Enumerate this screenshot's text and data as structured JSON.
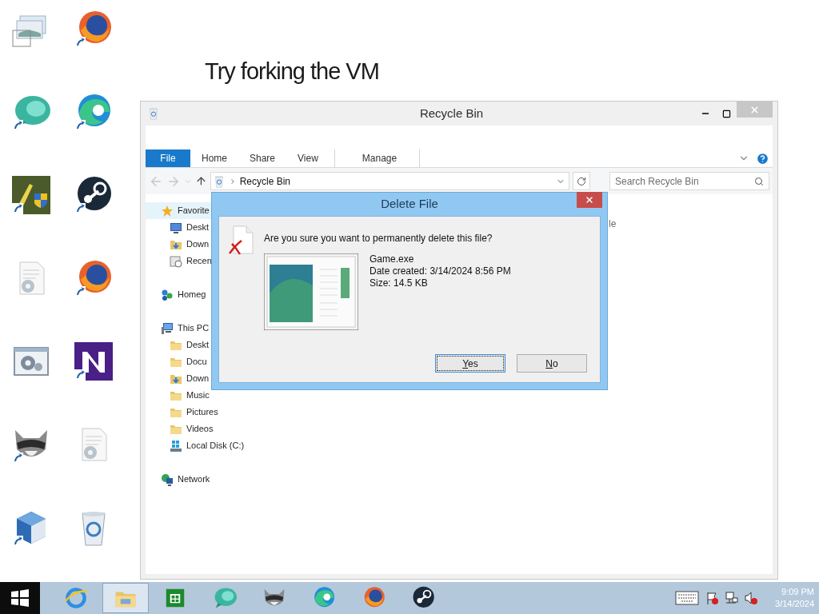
{
  "desktop": {
    "caption": "Try forking the VM",
    "icon_columns": [
      [
        {
          "kind": "windows",
          "shortcut": false
        },
        {
          "kind": "bubble",
          "shortcut": true
        },
        {
          "kind": "shield",
          "shortcut": true
        },
        {
          "kind": "docgear",
          "shortcut": false
        },
        {
          "kind": "gearwin",
          "shortcut": false
        },
        {
          "kind": "raccoon",
          "shortcut": true
        },
        {
          "kind": "cube",
          "shortcut": true
        }
      ],
      [
        {
          "kind": "globe",
          "shortcut": true
        },
        {
          "kind": "swirl",
          "shortcut": true
        },
        {
          "kind": "round",
          "shortcut": true
        },
        {
          "kind": "globe",
          "shortcut": true
        },
        {
          "kind": "square",
          "shortcut": true
        },
        {
          "kind": "docgear",
          "shortcut": false
        },
        {
          "kind": "bin",
          "shortcut": false
        }
      ]
    ]
  },
  "explorer": {
    "title": "Recycle Bin",
    "ribbon_tabs": [
      {
        "label": "File",
        "selected": true
      },
      {
        "label": "Home",
        "selected": false
      },
      {
        "label": "Share",
        "selected": false
      },
      {
        "label": "View",
        "selected": false
      },
      {
        "label": "Manage",
        "selected": false
      }
    ],
    "address": "Recycle Bin",
    "search": {
      "placeholder": "Search Recycle Bin"
    },
    "nav": [
      {
        "label": "Favorite",
        "kind": "star",
        "selected": true,
        "children": [
          {
            "label": "Deskt",
            "kind": "desktop",
            "selected": false
          },
          {
            "label": "Down",
            "kind": "download",
            "selected": false
          },
          {
            "label": "Recen",
            "kind": "recent",
            "selected": false
          }
        ]
      },
      {
        "label": "Homeg",
        "kind": "homegroup",
        "selected": false
      },
      {
        "label": "This PC",
        "kind": "pc",
        "selected": false,
        "children": [
          {
            "label": "Deskt",
            "kind": "folder",
            "selected": false
          },
          {
            "label": "Docu",
            "kind": "folder",
            "selected": false
          },
          {
            "label": "Down",
            "kind": "download",
            "selected": false
          },
          {
            "label": "Music",
            "kind": "folder",
            "selected": false
          },
          {
            "label": "Pictures",
            "kind": "folder",
            "selected": false
          },
          {
            "label": "Videos",
            "kind": "folder",
            "selected": false
          },
          {
            "label": "Local Disk (C:)",
            "kind": "disk",
            "selected": false
          }
        ]
      },
      {
        "label": "Network",
        "kind": "network",
        "selected": false
      }
    ],
    "column_1": "le"
  },
  "dialog": {
    "title": "Delete File",
    "message": "Are you sure you want to permanently delete this file?",
    "file_name": "Game.exe",
    "date_created": "Date created: 3/14/2024 8:56 PM",
    "size": "Size: 14.5 KB",
    "buttons": [
      {
        "label": "Yes",
        "focused": true
      },
      {
        "label": "No",
        "focused": false
      }
    ]
  },
  "taskbar": {
    "apps": [
      {
        "kind": "ring",
        "active": false
      },
      {
        "kind": "folder",
        "active": true
      },
      {
        "kind": "bag",
        "active": false
      },
      {
        "kind": "bubble",
        "active": false
      },
      {
        "kind": "raccoon",
        "active": false
      },
      {
        "kind": "swirl",
        "active": false
      },
      {
        "kind": "globe",
        "active": false
      },
      {
        "kind": "round",
        "active": false
      }
    ],
    "time": "9:09 PM",
    "date": "3/14/2024"
  }
}
